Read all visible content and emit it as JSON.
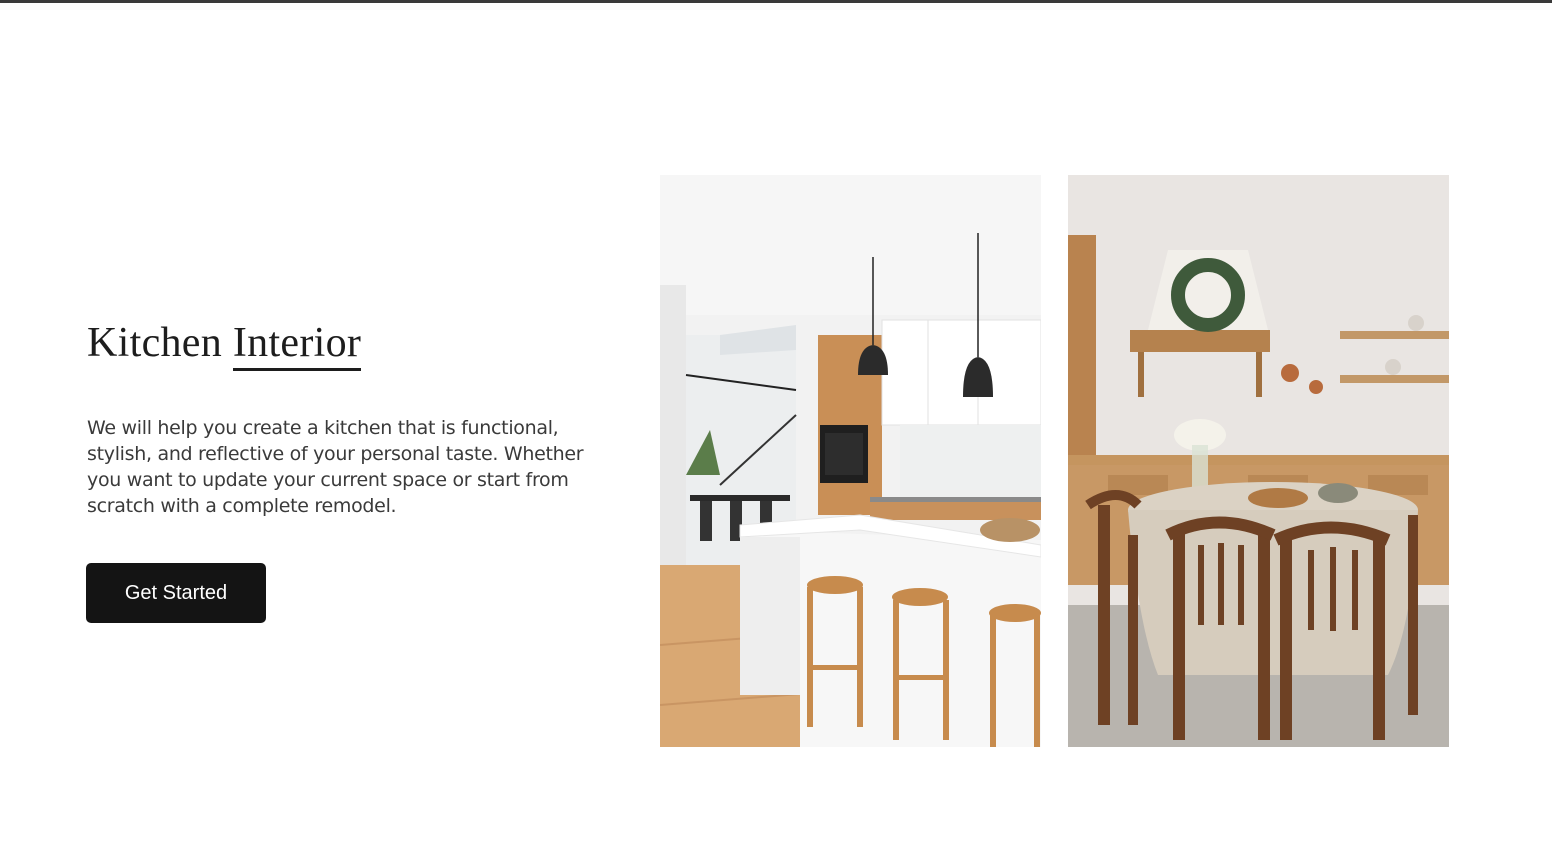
{
  "hero": {
    "title_part1": "Kitchen ",
    "title_part2": "Interior",
    "description": "We will help you create a kitchen that is functional, stylish, and reflective of your personal taste. Whether you want to update your current space or start from scratch with a complete remodel.",
    "cta_label": "Get Started"
  },
  "colors": {
    "text_dark": "#1d1d1d",
    "button_bg": "#141414",
    "button_text": "#ffffff",
    "top_border": "#3a3a3a"
  }
}
